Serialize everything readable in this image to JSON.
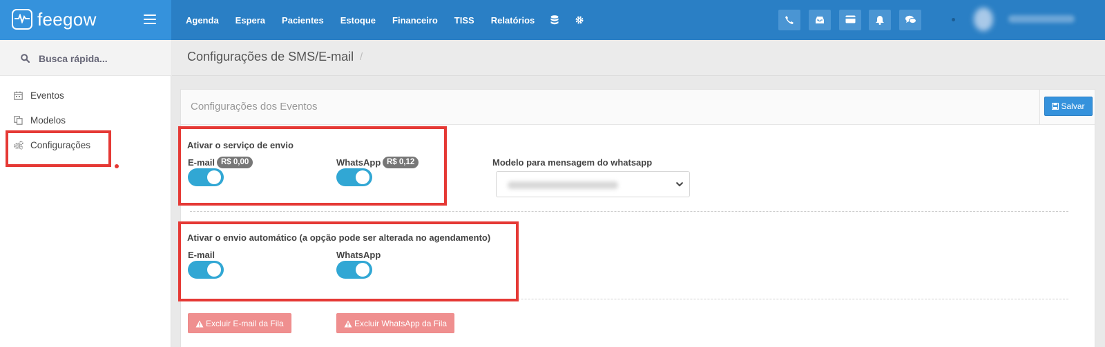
{
  "app": {
    "logo_text": "feegow"
  },
  "topnav": {
    "items": [
      "Agenda",
      "Espera",
      "Pacientes",
      "Estoque",
      "Financeiro",
      "TISS",
      "Relatórios"
    ]
  },
  "sidebar": {
    "search_placeholder": "Busca rápida...",
    "items": [
      {
        "label": "Eventos",
        "icon": "calendar-icon"
      },
      {
        "label": "Modelos",
        "icon": "copy-icon"
      },
      {
        "label": "Configurações",
        "icon": "cogs-icon"
      }
    ]
  },
  "page": {
    "title": "Configurações de SMS/E-mail",
    "breadcrumb_separator": "/"
  },
  "panel": {
    "title": "Configurações dos Eventos",
    "save_label": "Salvar",
    "service": {
      "heading": "Ativar o serviço de envio",
      "email_label": "E-mail",
      "email_price": "R$ 0,00",
      "email_on": true,
      "whatsapp_label": "WhatsApp",
      "whatsapp_price": "R$ 0,12",
      "whatsapp_on": true
    },
    "whatsapp_model": {
      "label": "Modelo para mensagem do whatsapp"
    },
    "auto": {
      "heading": "Ativar o envio automático (a opção pode ser alterada no agendamento)",
      "email_label": "E-mail",
      "email_on": true,
      "whatsapp_label": "WhatsApp",
      "whatsapp_on": true
    },
    "delete_email_label": "Excluir E-mail da Fila",
    "delete_whatsapp_label": "Excluir WhatsApp da Fila"
  },
  "colors": {
    "topbar": "#2a7fc5",
    "brand": "#3592dc",
    "toggle_on": "#31a7d4",
    "danger_soft": "#ef8f8f",
    "highlight": "#e53935"
  }
}
